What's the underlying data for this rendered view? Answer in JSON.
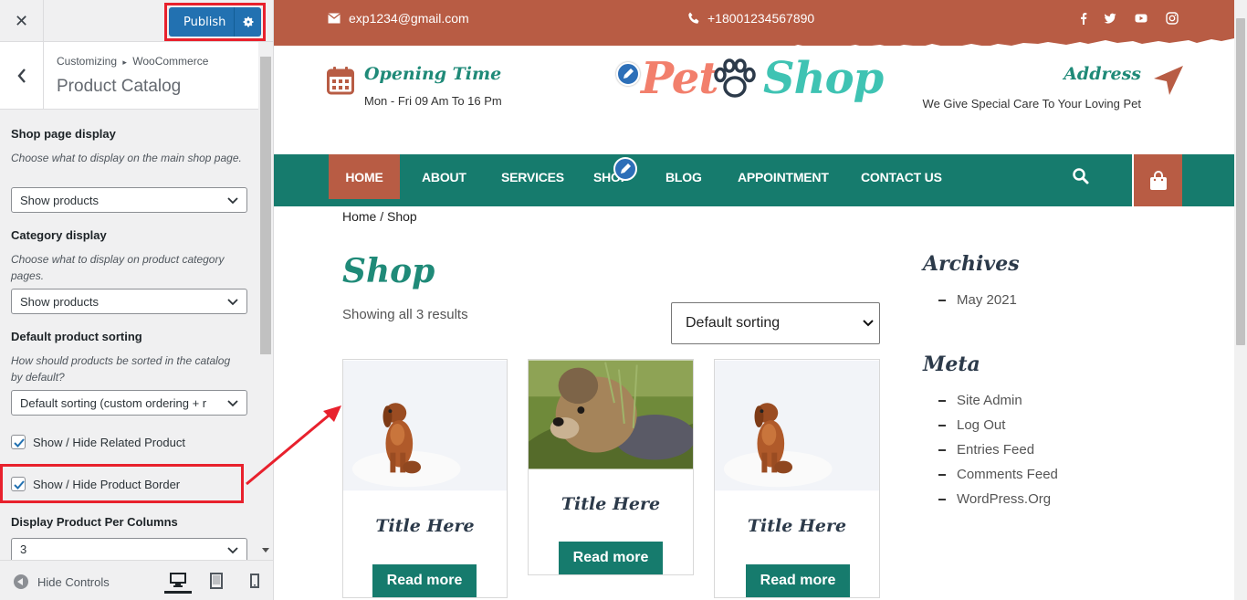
{
  "customizer": {
    "close_label": "✕",
    "publish_label": "Publish",
    "breadcrumb_root": "Customizing",
    "breadcrumb_sep": "▸",
    "breadcrumb_parent": "WooCommerce",
    "section_title": "Product Catalog",
    "controls": {
      "shop_page_display": {
        "label": "Shop page display",
        "description": "Choose what to display on the main shop page.",
        "value": "Show products"
      },
      "category_display": {
        "label": "Category display",
        "description": "Choose what to display on product category pages.",
        "value": "Show products"
      },
      "default_sorting": {
        "label": "Default product sorting",
        "description": "How should products be sorted in the catalog by default?",
        "value": "Default sorting (custom ordering + r"
      },
      "related_product": {
        "label": "Show / Hide Related Product",
        "checked": true
      },
      "product_border": {
        "label": "Show / Hide Product Border",
        "checked": true
      },
      "per_columns": {
        "label": "Display Product Per Columns",
        "value": "3"
      }
    },
    "footer": {
      "hide_controls_label": "Hide Controls"
    },
    "colors": {
      "primary": "#2271b1",
      "highlight": "#e8212d"
    }
  },
  "site": {
    "topbar": {
      "email": "exp1234@gmail.com",
      "phone": "+18001234567890",
      "social": [
        "facebook-icon",
        "twitter-icon",
        "youtube-icon",
        "instagram-icon"
      ]
    },
    "header": {
      "opening_title": "Opening Time",
      "opening_text": "Mon - Fri 09 Am To 16 Pm",
      "logo_word1": "Pet",
      "logo_word2": "Shop",
      "address_title": "Address",
      "address_text": "We Give Special Care To Your Loving Pet"
    },
    "nav": [
      "HOME",
      "ABOUT",
      "SERVICES",
      "SHOP",
      "BLOG",
      "APPOINTMENT",
      "CONTACT US"
    ],
    "breadcrumb": "Home / Shop",
    "shop_title": "Shop",
    "result_count": "Showing all 3 results",
    "sorting": "Default sorting",
    "products": [
      {
        "title": "Title Here",
        "button": "Read more",
        "image": "dog-sitting-image"
      },
      {
        "title": "Title Here",
        "button": "Read more",
        "image": "yorkie-image"
      },
      {
        "title": "Title Here",
        "button": "Read more",
        "image": "dog-sitting-image"
      }
    ],
    "widgets": {
      "archives_title": "Archives",
      "archives": [
        "May 2021"
      ],
      "meta_title": "Meta",
      "meta": [
        "Site Admin",
        "Log Out",
        "Entries Feed",
        "Comments Feed",
        "WordPress.Org"
      ]
    },
    "colors": {
      "topbar": "#b85c44",
      "nav": "#167b6d",
      "accent_green": "#1f8a78",
      "logo_pet": "#f27f6c",
      "logo_shop": "#3fc3b3"
    }
  }
}
